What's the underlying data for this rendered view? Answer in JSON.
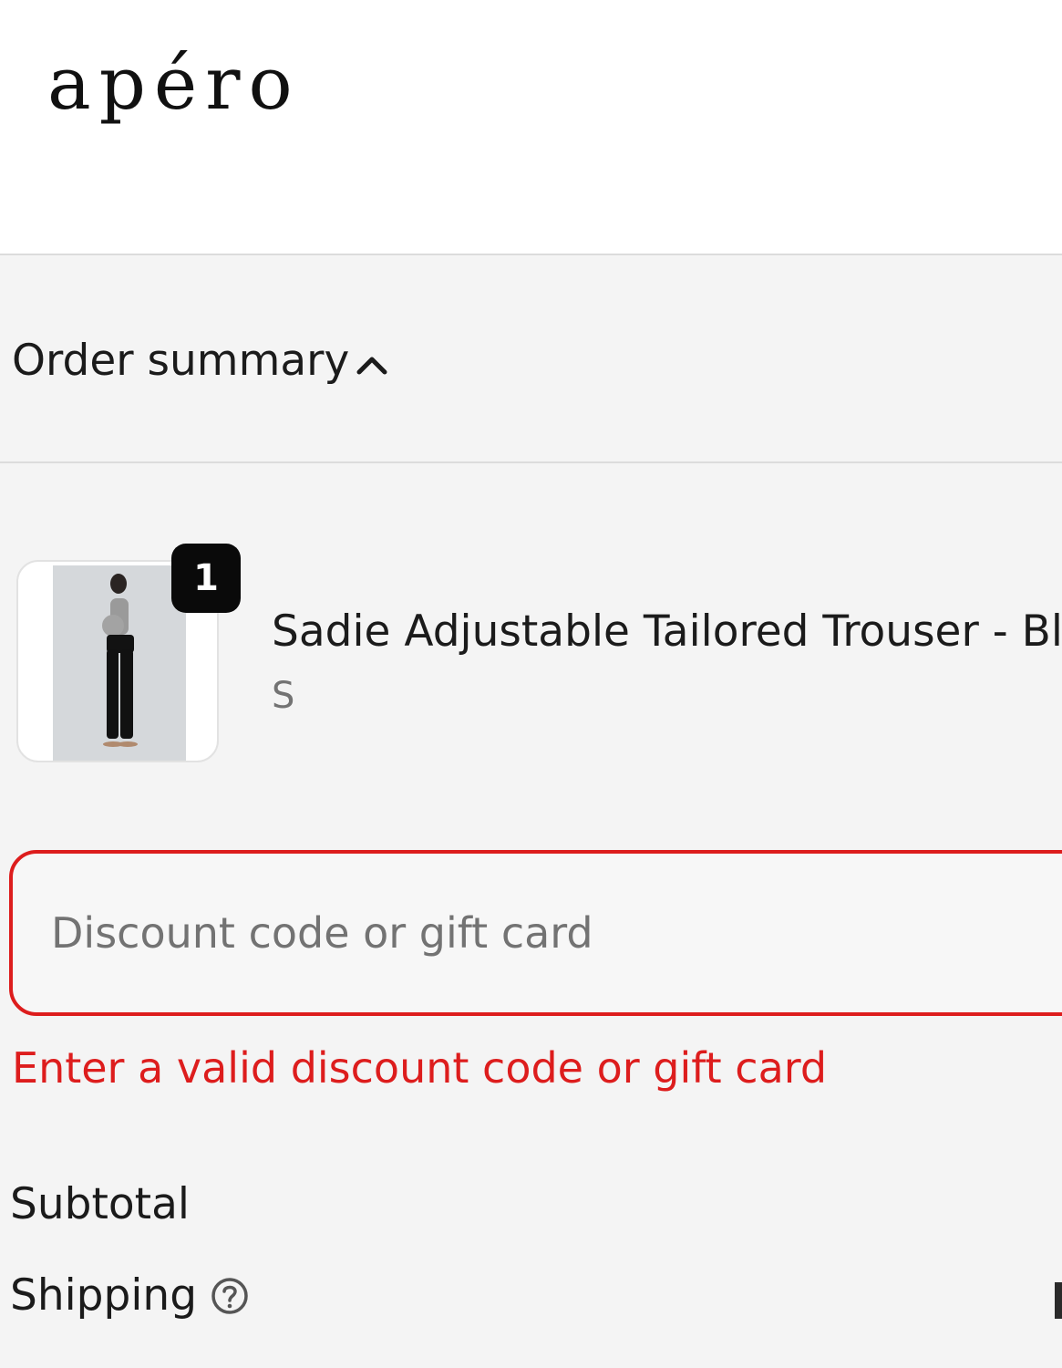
{
  "header": {
    "logo_text": "apéro"
  },
  "summary_toggle": {
    "label": "Order summary",
    "icon": "chevron-up-icon"
  },
  "line_item": {
    "quantity": "1",
    "name": "Sadie Adjustable Tailored Trouser - Blac",
    "variant": "S"
  },
  "discount": {
    "placeholder": "Discount code or gift card",
    "value": "",
    "error": "Enter a valid discount code or gift card"
  },
  "totals": {
    "subtotal_label": "Subtotal",
    "shipping_label": "Shipping",
    "shipping_help_icon": "question-circle-icon"
  },
  "colors": {
    "error": "#dd1d1d",
    "summary_background": "#f4f4f4",
    "badge": "#0a0a0a",
    "text": "#1b1b1b",
    "muted_text": "#737373"
  }
}
